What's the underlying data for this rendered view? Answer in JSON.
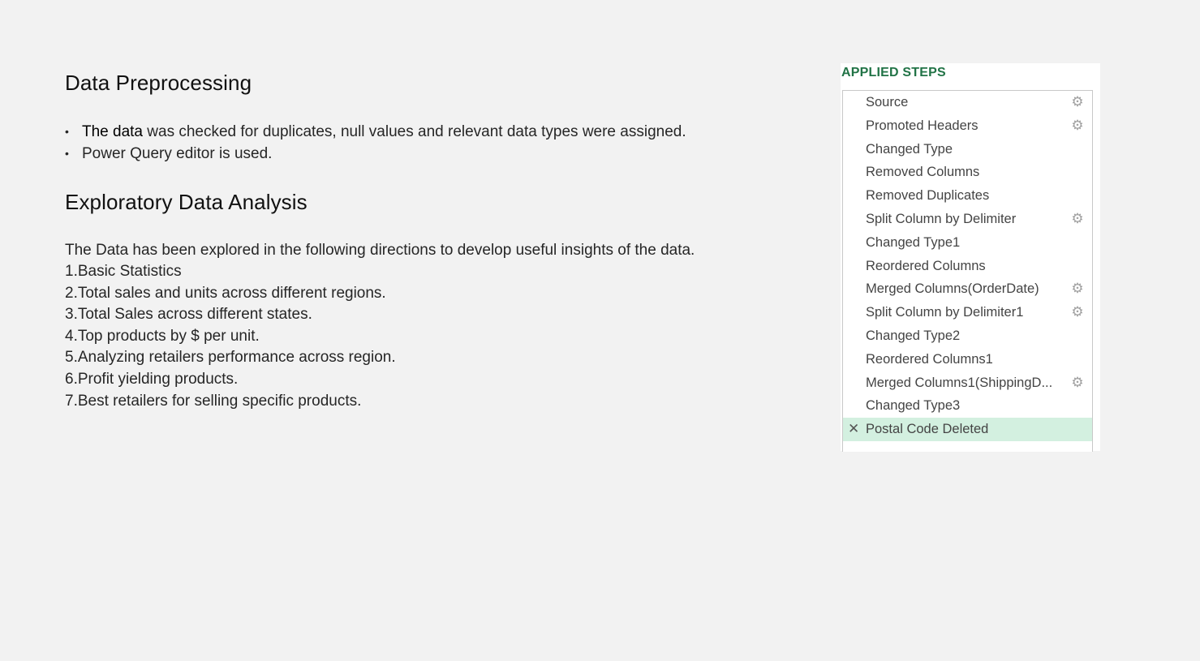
{
  "section1": {
    "title": "Data Preprocessing",
    "bullet_symbol": "•",
    "bullets": [
      {
        "strong": "The data",
        "rest": " was checked for duplicates, null values and relevant data types were assigned."
      },
      {
        "strong": "",
        "rest": "Power Query editor is used."
      }
    ]
  },
  "section2": {
    "title": "Exploratory Data Analysis",
    "intro": "The Data has been explored in the following directions to develop useful insights of the data.",
    "directions": [
      "1.Basic Statistics",
      "2.Total sales and units across different regions.",
      "3.Total Sales across different states.",
      "4.Top products by $ per unit.",
      "5.Analyzing retailers performance across region.",
      "6.Profit yielding products.",
      "7.Best retailers for selling specific products."
    ]
  },
  "applied_steps": {
    "title": "APPLIED STEPS",
    "gear_icon": "gear-icon",
    "delete_icon": "close-icon",
    "steps": [
      {
        "label": "Source",
        "has_gear": true,
        "selected": false
      },
      {
        "label": "Promoted Headers",
        "has_gear": true,
        "selected": false
      },
      {
        "label": "Changed Type",
        "has_gear": false,
        "selected": false
      },
      {
        "label": "Removed Columns",
        "has_gear": false,
        "selected": false
      },
      {
        "label": "Removed Duplicates",
        "has_gear": false,
        "selected": false
      },
      {
        "label": "Split Column by Delimiter",
        "has_gear": true,
        "selected": false
      },
      {
        "label": "Changed Type1",
        "has_gear": false,
        "selected": false
      },
      {
        "label": "Reordered Columns",
        "has_gear": false,
        "selected": false
      },
      {
        "label": "Merged Columns(OrderDate)",
        "has_gear": true,
        "selected": false
      },
      {
        "label": "Split Column by Delimiter1",
        "has_gear": true,
        "selected": false
      },
      {
        "label": "Changed Type2",
        "has_gear": false,
        "selected": false
      },
      {
        "label": "Reordered Columns1",
        "has_gear": false,
        "selected": false
      },
      {
        "label": "Merged Columns1(ShippingD...",
        "has_gear": true,
        "selected": false
      },
      {
        "label": "Changed Type3",
        "has_gear": false,
        "selected": false
      },
      {
        "label": "Postal Code Deleted",
        "has_gear": false,
        "selected": true
      }
    ]
  },
  "colors": {
    "background": "#f2f2f2",
    "steps_title": "#217346",
    "selected_step": "#d3f0e0"
  }
}
